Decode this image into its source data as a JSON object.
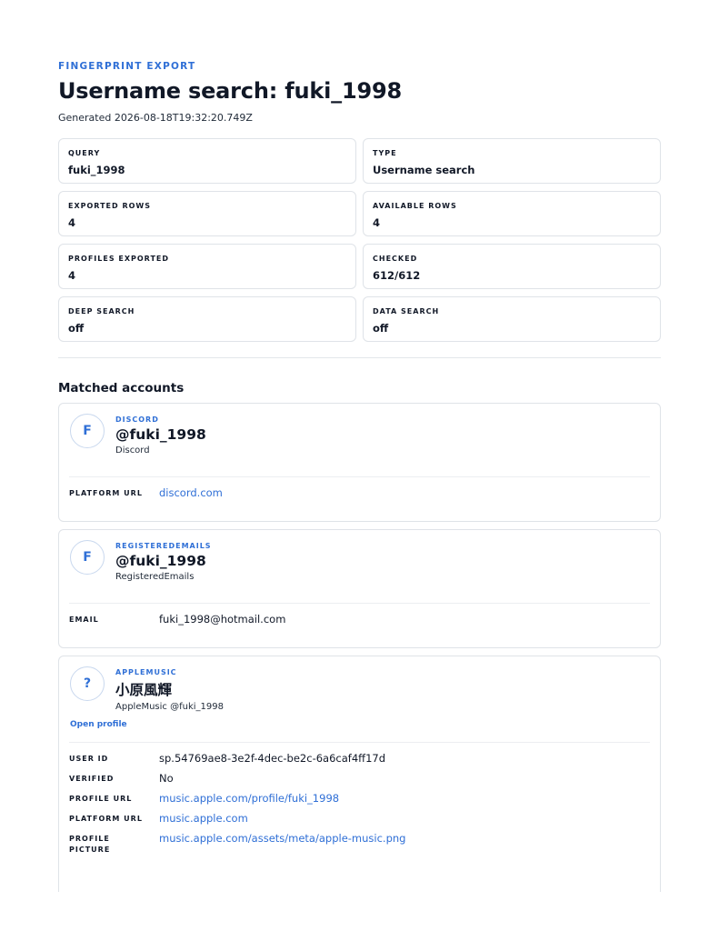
{
  "header": {
    "eyebrow": "FINGERPRINT EXPORT",
    "title": "Username search: fuki_1998",
    "generated": "Generated 2026-08-18T19:32:20.749Z"
  },
  "stats": [
    {
      "label": "QUERY",
      "value": "fuki_1998"
    },
    {
      "label": "TYPE",
      "value": "Username search"
    },
    {
      "label": "EXPORTED ROWS",
      "value": "4"
    },
    {
      "label": "AVAILABLE ROWS",
      "value": "4"
    },
    {
      "label": "PROFILES EXPORTED",
      "value": "4"
    },
    {
      "label": "CHECKED",
      "value": "612/612"
    },
    {
      "label": "DEEP SEARCH",
      "value": "off"
    },
    {
      "label": "DATA SEARCH",
      "value": "off"
    }
  ],
  "section_title": "Matched accounts",
  "accounts": [
    {
      "avatar": "F",
      "platform": "DISCORD",
      "handle": "@fuki_1998",
      "sub": "Discord",
      "fields": [
        {
          "label": "PLATFORM URL",
          "value": "discord.com"
        }
      ]
    },
    {
      "avatar": "F",
      "platform": "REGISTEREDEMAILS",
      "handle": "@fuki_1998",
      "sub": "RegisteredEmails",
      "fields": [
        {
          "label": "EMAIL",
          "value": "fuki_1998@hotmail.com"
        }
      ]
    },
    {
      "avatar": "?",
      "platform": "APPLEMUSIC",
      "handle": "小原風輝",
      "sub": "AppleMusic @fuki_1998",
      "open_link": "Open profile",
      "fields": [
        {
          "label": "USER ID",
          "value": "sp.54769ae8-3e2f-4dec-be2c-6a6caf4ff17d"
        },
        {
          "label": "VERIFIED",
          "value": "No"
        },
        {
          "label": "PROFILE URL",
          "value": "music.apple.com/profile/fuki_1998"
        },
        {
          "label": "PLATFORM URL",
          "value": "music.apple.com"
        },
        {
          "label": "PROFILE PICTURE",
          "value": "music.apple.com/assets/meta/apple-music.png"
        }
      ]
    }
  ],
  "colors": {
    "accent": "#2f6fd6",
    "text": "#111827",
    "border": "#dfe3e8"
  }
}
